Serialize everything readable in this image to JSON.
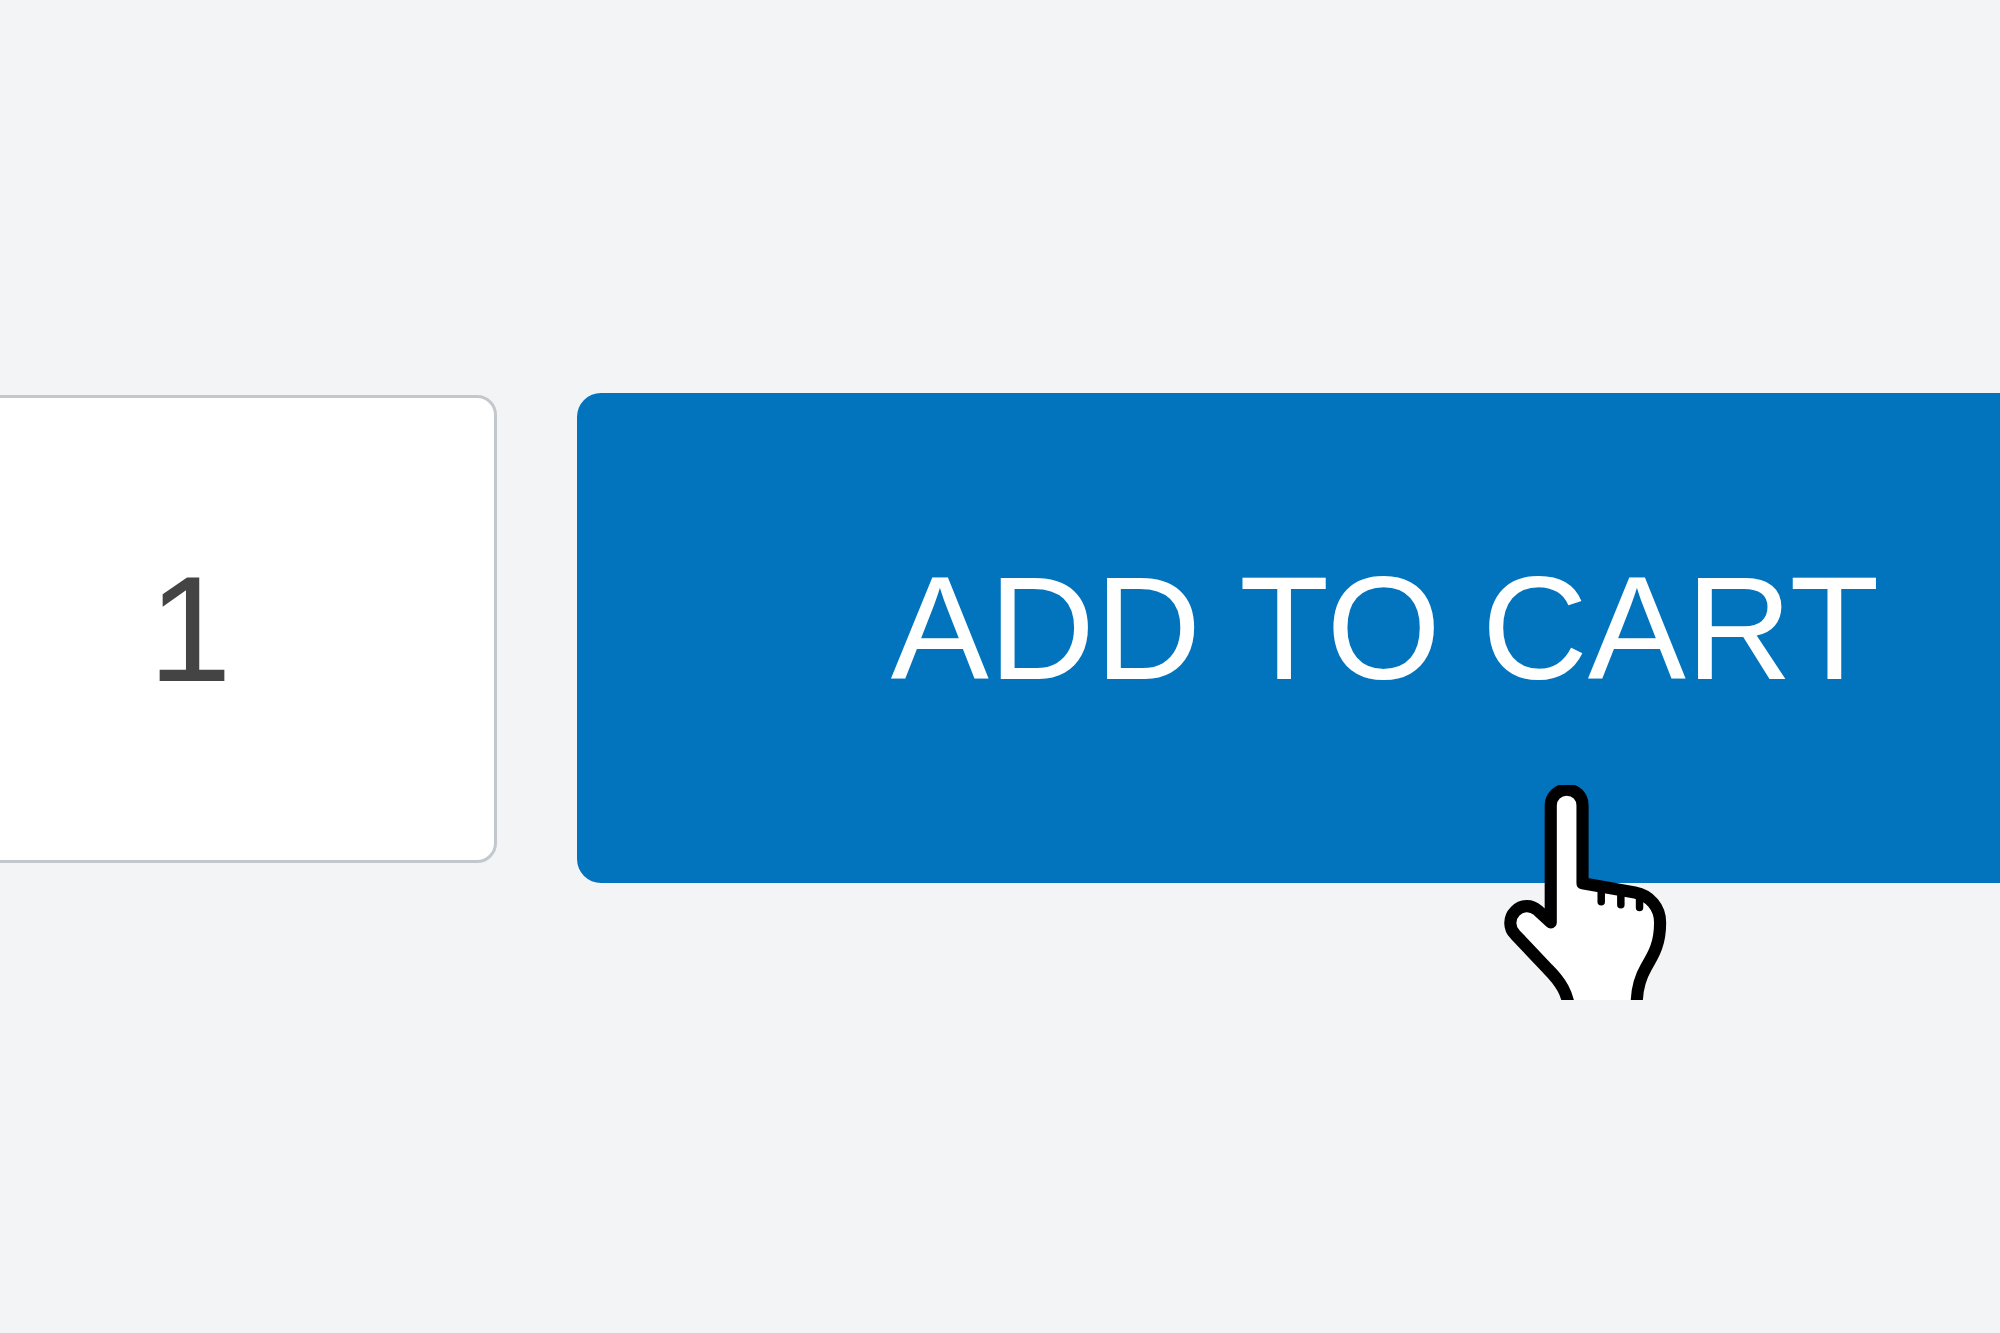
{
  "quantity_field": {
    "value": "1"
  },
  "add_to_cart_button": {
    "label": "ADD TO CART"
  }
}
